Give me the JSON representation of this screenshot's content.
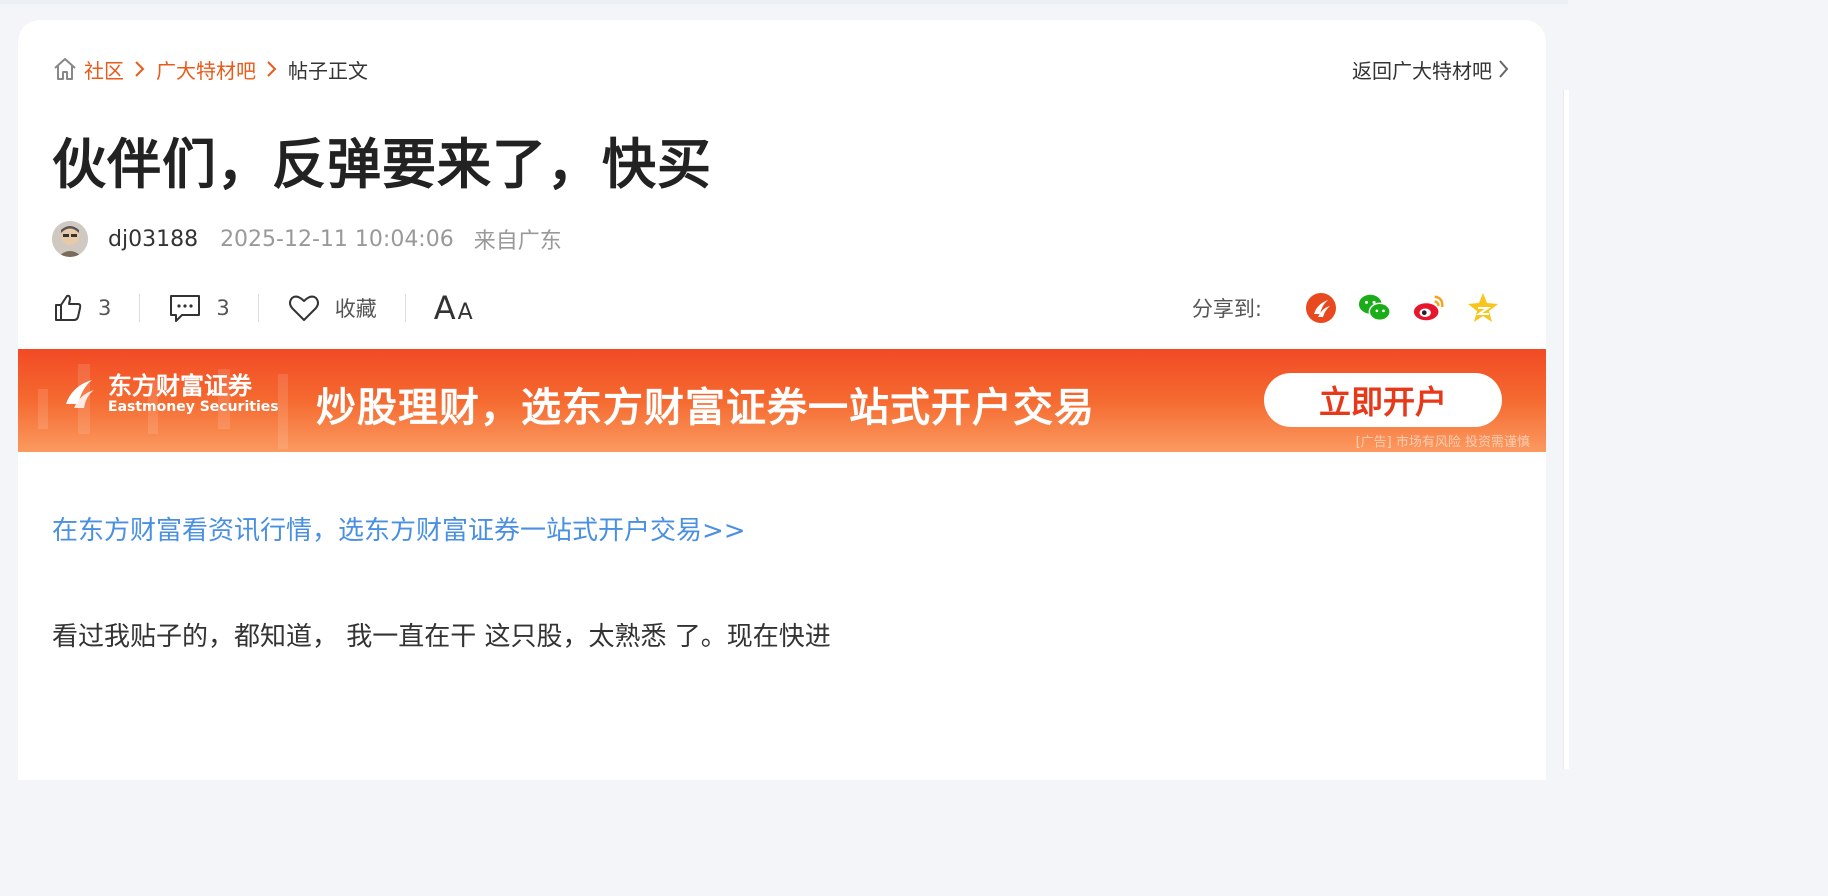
{
  "breadcrumb": {
    "home_icon": "home-icon",
    "items": [
      "社区",
      "广大特材吧"
    ],
    "current": "帖子正文",
    "back_label": "返回广大特材吧"
  },
  "post": {
    "title": "伙伴们，反弹要来了，快买",
    "author": "dj03188",
    "time": "2025-12-11 10:04:06",
    "location": "来自广东",
    "likes": "3",
    "comments": "3",
    "favorite_label": "收藏",
    "font_big": "A",
    "font_small": "A",
    "body": "看过我贴子的，都知道， 我一直在干 这只股，太熟悉 了。现在快进"
  },
  "share": {
    "label": "分享到:",
    "targets": [
      "eastmoney-icon",
      "wechat-icon",
      "weibo-icon",
      "qzone-icon"
    ]
  },
  "banner": {
    "logo_cn": "东方财富证券",
    "logo_en": "Eastmoney Securities",
    "slogan": "炒股理财，选东方财富证券一站式开户交易",
    "button": "立即开户",
    "disclaimer": "[广告] 市场有风险 投资需谨慎"
  },
  "promo_link": "在东方财富看资讯行情，选东方财富证券一站式开户交易>>",
  "colors": {
    "accent": "#ea5b1a",
    "link": "#4a90e2",
    "banner": "#f24a25"
  }
}
